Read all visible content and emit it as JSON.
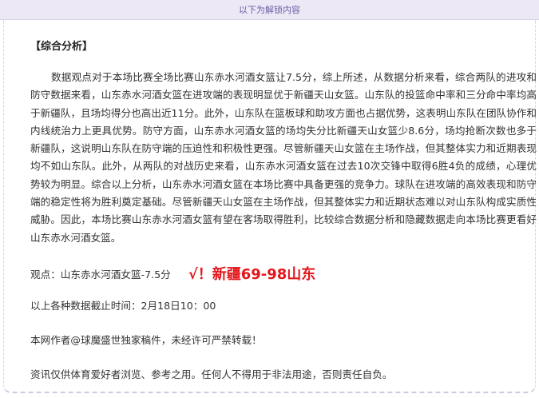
{
  "banner": {
    "text": "以下为解锁内容"
  },
  "section": {
    "heading": "【综合分析】"
  },
  "analysis": {
    "paragraph": "数据观点对于本场比赛全场比赛山东赤水河酒女篮让7.5分，综上所述，从数据分析来看，综合两队的进攻和防守数据来看，山东赤水河酒女篮在进攻端的表现明显优于新疆天山女篮。山东队的投篮命中率和三分命中率均高于新疆队，且场均得分也高出近11分。此外，山东队在篮板球和助攻方面也占据优势，这表明山东队在团队协作和内线统治力上更具优势。防守方面，山东赤水河酒女篮的场均失分比新疆天山女篮少8.6分，场均抢断次数也多于新疆队，这说明山东队在防守端的压迫性和积极性更强。尽管新疆天山女篮在主场作战，但其整体实力和近期表现均不如山东队。此外，从两队的对战历史来看，山东赤水河酒女篮在过去10次交锋中取得6胜4负的成绩，心理优势较为明显。综合以上分析，山东赤水河酒女篮在本场比赛中具备更强的竞争力。球队在进攻端的高效表现和防守端的稳定性将为胜利奠定基础。尽管新疆天山女篮在主场作战，但其整体实力和近期状态难以对山东队构成实质性威胁。因此，本场比赛山东赤水河酒女篮有望在客场取得胜利，比较综合数据分析和隐藏数据走向本场比赛更看好山东赤水河酒女篮。"
  },
  "opinion": {
    "label": "观点：山东赤水河酒女篮-7.5分",
    "result": "√！新疆69-98山东"
  },
  "footer": {
    "cutoff": "以上各种数据截止时间：2月18日10：00",
    "author": "本网作者@球魔盛世独家稿件，未经许可严禁转载！",
    "disclaimer": "资讯仅供体育爱好者浏览、参考之用。任何人不得用于非法用途，否则责任自负。"
  },
  "colors": {
    "banner_bg": "#ece8f6",
    "banner_text": "#6c61a3",
    "result": "#e4161b"
  }
}
